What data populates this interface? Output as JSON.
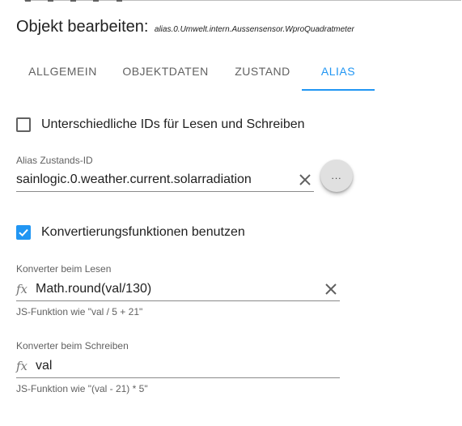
{
  "dialog": {
    "title": "Objekt bearbeiten:",
    "object_id": "alias.0.Umwelt.intern.Aussensensor.WproQuadratmeter"
  },
  "tabs": [
    {
      "label": "ALLGEMEIN",
      "active": false
    },
    {
      "label": "OBJEKTDATEN",
      "active": false
    },
    {
      "label": "ZUSTAND",
      "active": false
    },
    {
      "label": "ALIAS",
      "active": true
    }
  ],
  "different_ids": {
    "label": "Unterschiedliche IDs für Lesen und Schreiben",
    "checked": false
  },
  "alias_state_id": {
    "label": "Alias Zustands-ID",
    "value": "sainlogic.0.weather.current.solarradiation",
    "more_label": "..."
  },
  "conversion": {
    "label": "Konvertierungsfunktionen benutzen",
    "checked": true
  },
  "read_converter": {
    "label": "Konverter beim Lesen",
    "icon": "fx",
    "value": "Math.round(val/130)",
    "helper": "JS-Funktion wie \"val / 5 + 21\""
  },
  "write_converter": {
    "label": "Konverter beim Schreiben",
    "icon": "fx",
    "value": "val",
    "helper": "JS-Funktion wie \"(val - 21) * 5\""
  },
  "colors": {
    "accent": "#2196f3",
    "text": "#212121",
    "secondary": "#616161"
  }
}
